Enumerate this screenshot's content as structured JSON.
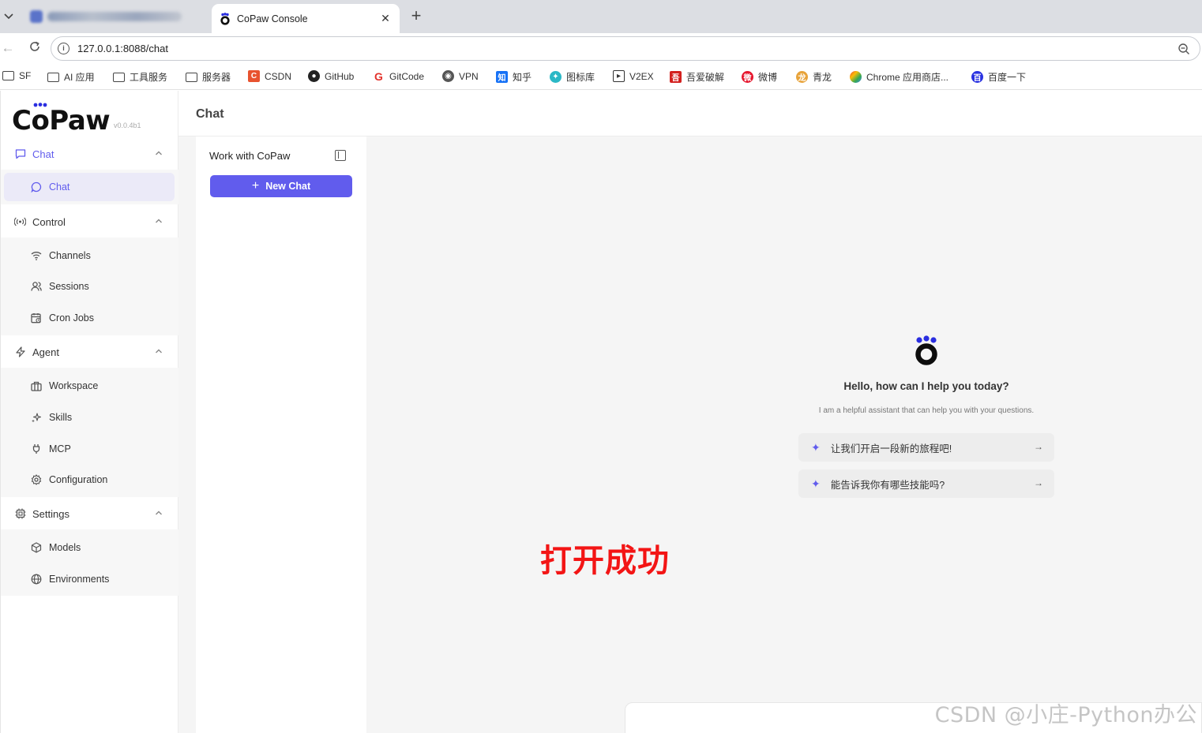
{
  "browser": {
    "active_tab_title": "CoPaw Console",
    "url": "127.0.0.1:8088/chat",
    "bookmarks": [
      {
        "label": "SF",
        "icon": "folder-icon"
      },
      {
        "label": "AI 应用",
        "icon": "folder-icon"
      },
      {
        "label": "工具服务",
        "icon": "folder-icon"
      },
      {
        "label": "服务器",
        "icon": "folder-icon"
      },
      {
        "label": "CSDN",
        "icon": "csdn-icon",
        "color": "#e8532f"
      },
      {
        "label": "GitHub",
        "icon": "github-icon",
        "color": "#222222"
      },
      {
        "label": "GitCode",
        "icon": "gitcode-icon",
        "color": "#e3322b"
      },
      {
        "label": "VPN",
        "icon": "vpn-icon",
        "color": "#333333"
      },
      {
        "label": "知乎",
        "icon": "zhihu-icon",
        "color": "#1772f6"
      },
      {
        "label": "图标库",
        "icon": "iconfont-icon",
        "color": "#2bb8c6"
      },
      {
        "label": "V2EX",
        "icon": "v2ex-icon",
        "color": "#333333"
      },
      {
        "label": "吾爱破解",
        "icon": "52pojie-icon",
        "color": "#d3211f"
      },
      {
        "label": "微博",
        "icon": "weibo-icon",
        "color": "#e6162d"
      },
      {
        "label": "青龙",
        "icon": "qinglong-icon",
        "color": "#e8a33a"
      },
      {
        "label": "Chrome 应用商店...",
        "icon": "chrome-store-icon",
        "color": "#4285f4"
      },
      {
        "label": "百度一下",
        "icon": "baidu-icon",
        "color": "#2932e1"
      }
    ]
  },
  "app": {
    "logo": "CoPaw",
    "version": "v0.0.4b1",
    "accent_color": "#615ced",
    "page_title": "Chat",
    "sidebar": {
      "groups": [
        {
          "label": "Chat",
          "icon": "message-square-icon",
          "items": [
            {
              "label": "Chat",
              "icon": "message-circle-icon"
            }
          ]
        },
        {
          "label": "Control",
          "icon": "broadcast-icon",
          "items": [
            {
              "label": "Channels",
              "icon": "wifi-icon"
            },
            {
              "label": "Sessions",
              "icon": "users-icon"
            },
            {
              "label": "Cron Jobs",
              "icon": "calendar-clock-icon"
            }
          ]
        },
        {
          "label": "Agent",
          "icon": "zap-icon",
          "items": [
            {
              "label": "Workspace",
              "icon": "briefcase-icon"
            },
            {
              "label": "Skills",
              "icon": "sparkles-icon"
            },
            {
              "label": "MCP",
              "icon": "plug-icon"
            },
            {
              "label": "Configuration",
              "icon": "gear-icon"
            }
          ]
        },
        {
          "label": "Settings",
          "icon": "cpu-icon",
          "items": [
            {
              "label": "Models",
              "icon": "box-icon"
            },
            {
              "label": "Environments",
              "icon": "globe-icon"
            }
          ]
        }
      ]
    },
    "conversations": {
      "title": "Work with CoPaw",
      "new_chat_label": "New Chat"
    },
    "welcome": {
      "greeting": "Hello, how can I help you today?",
      "subtitle": "I am a helpful assistant that can help you with your questions.",
      "prompts": [
        "让我们开启一段新的旅程吧!",
        "能告诉我你有哪些技能吗?"
      ]
    }
  },
  "overlay": {
    "annotation": "打开成功",
    "annotation_color": "#f31515",
    "watermark": "CSDN @小庄-Python办公"
  }
}
